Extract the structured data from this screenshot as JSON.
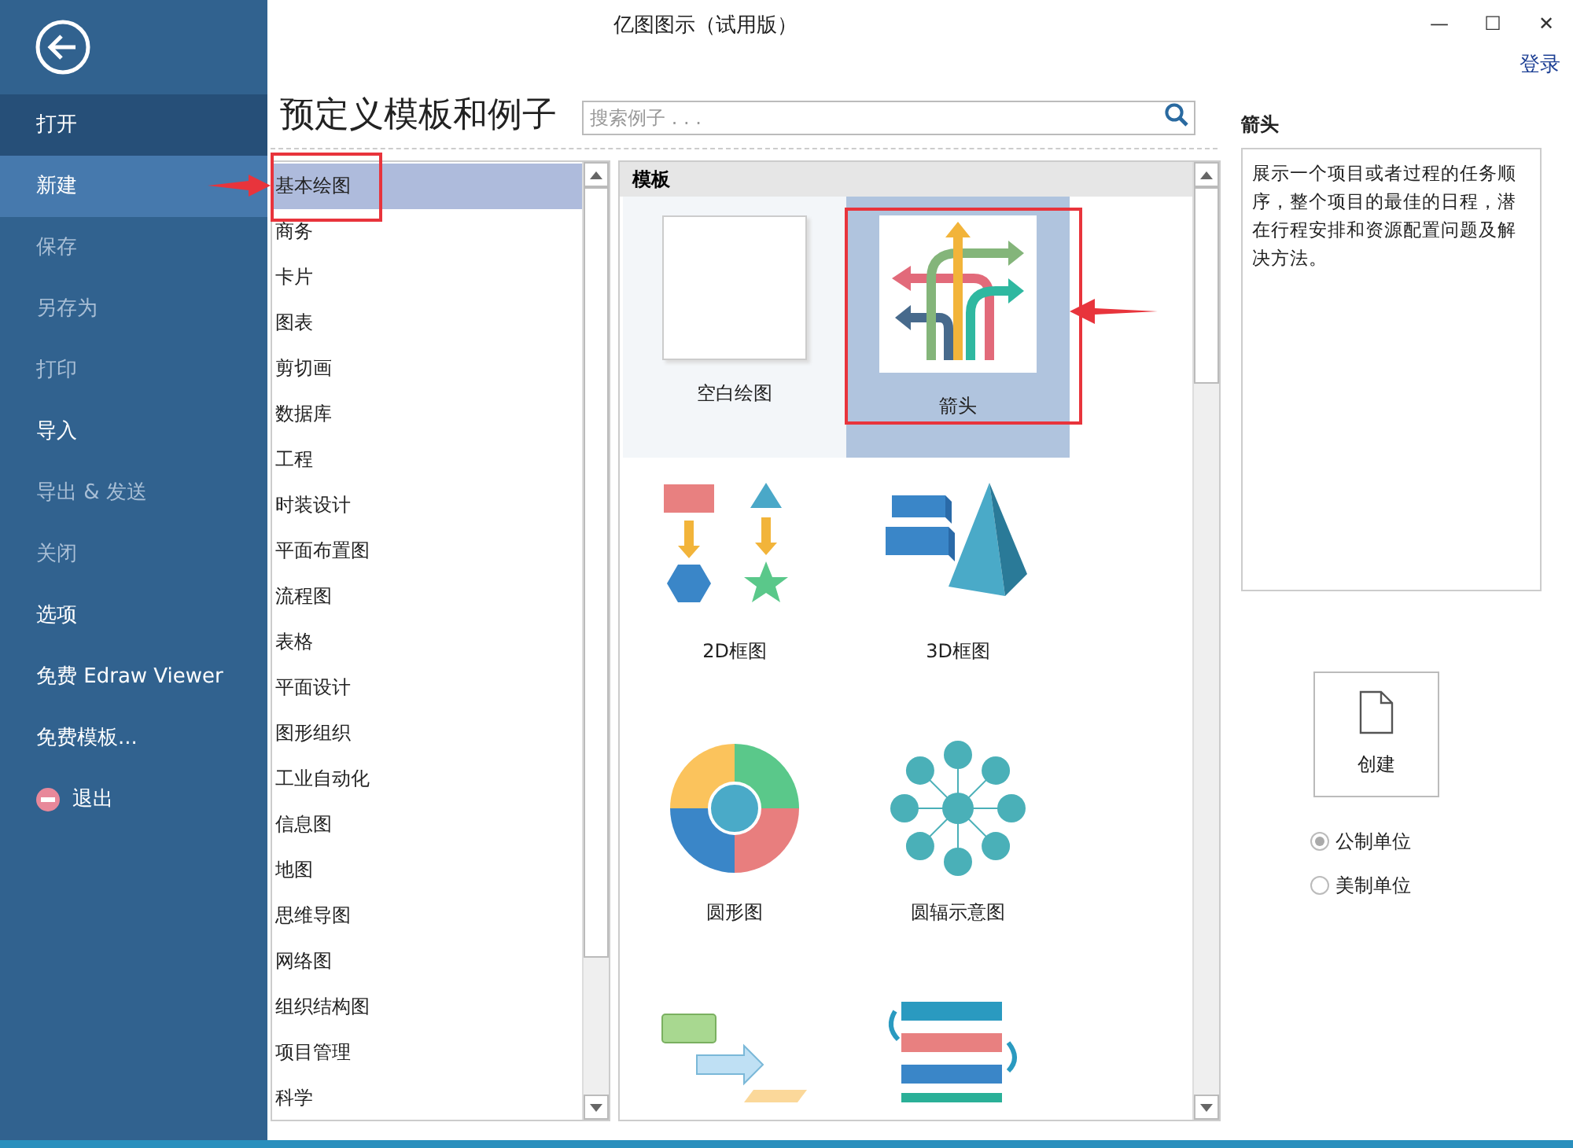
{
  "window": {
    "title": "亿图图示（试用版）",
    "controls": [
      "—",
      "☐",
      "✕"
    ],
    "login": "登录"
  },
  "sidebar": {
    "items": [
      {
        "label": "打开",
        "selected": false,
        "hovered": true,
        "disabled": false
      },
      {
        "label": "新建",
        "selected": true,
        "hovered": false,
        "disabled": false
      },
      {
        "label": "保存",
        "selected": false,
        "hovered": false,
        "disabled": true
      },
      {
        "label": "另存为",
        "selected": false,
        "hovered": false,
        "disabled": true
      },
      {
        "label": "打印",
        "selected": false,
        "hovered": false,
        "disabled": true
      },
      {
        "label": "导入",
        "selected": false,
        "hovered": false,
        "disabled": false
      },
      {
        "label": "导出 & 发送",
        "selected": false,
        "hovered": false,
        "disabled": true
      },
      {
        "label": "关闭",
        "selected": false,
        "hovered": false,
        "disabled": true
      },
      {
        "label": "选项",
        "selected": false,
        "hovered": false,
        "disabled": false
      },
      {
        "label": "免费 Edraw Viewer",
        "selected": false,
        "hovered": false,
        "disabled": false
      },
      {
        "label": "免费模板...",
        "selected": false,
        "hovered": false,
        "disabled": false
      },
      {
        "label": "退出",
        "selected": false,
        "hovered": false,
        "disabled": false,
        "kind": "exit"
      }
    ]
  },
  "heading": "预定义模板和例子",
  "search": {
    "placeholder": "搜索例子 . . ."
  },
  "categories": [
    {
      "label": "基本绘图",
      "selected": true
    },
    {
      "label": "商务",
      "selected": false
    },
    {
      "label": "卡片",
      "selected": false
    },
    {
      "label": "图表",
      "selected": false
    },
    {
      "label": "剪切画",
      "selected": false
    },
    {
      "label": "数据库",
      "selected": false
    },
    {
      "label": "工程",
      "selected": false
    },
    {
      "label": "时装设计",
      "selected": false
    },
    {
      "label": "平面布置图",
      "selected": false
    },
    {
      "label": "流程图",
      "selected": false
    },
    {
      "label": "表格",
      "selected": false
    },
    {
      "label": "平面设计",
      "selected": false
    },
    {
      "label": "图形组织",
      "selected": false
    },
    {
      "label": "工业自动化",
      "selected": false
    },
    {
      "label": "信息图",
      "selected": false
    },
    {
      "label": "地图",
      "selected": false
    },
    {
      "label": "思维导图",
      "selected": false
    },
    {
      "label": "网络图",
      "selected": false
    },
    {
      "label": "组织结构图",
      "selected": false
    },
    {
      "label": "项目管理",
      "selected": false
    },
    {
      "label": "科学",
      "selected": false
    }
  ],
  "templates": {
    "header": "模板",
    "items": [
      {
        "kind": "blank",
        "label": "空白绘图",
        "selected": false
      },
      {
        "kind": "arrows",
        "label": "箭头",
        "selected": true
      },
      {
        "kind": "block2d",
        "label": "2D框图",
        "selected": false
      },
      {
        "kind": "block3d",
        "label": "3D框图",
        "selected": false
      },
      {
        "kind": "circle",
        "label": "圆形图",
        "selected": false
      },
      {
        "kind": "spoke",
        "label": "圆辐示意图",
        "selected": false
      },
      {
        "kind": "flow",
        "selected": false
      },
      {
        "kind": "list",
        "selected": false
      }
    ]
  },
  "details": {
    "title": "箭头",
    "description": "展示一个项目或者过程的任务顺序，整个项目的最佳的日程，潜在行程安排和资源配置问题及解决方法。",
    "create": "创建",
    "units": [
      {
        "label": "公制单位",
        "selected": true
      },
      {
        "label": "美制单位",
        "selected": false
      }
    ]
  }
}
